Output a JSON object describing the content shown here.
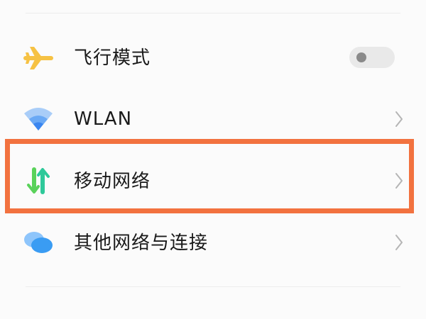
{
  "settings": {
    "items": [
      {
        "label": "飞行模式",
        "icon": "airplane-icon",
        "control": "toggle",
        "toggle_on": false
      },
      {
        "label": "WLAN",
        "icon": "wifi-icon",
        "control": "chevron"
      },
      {
        "label": "移动网络",
        "icon": "mobile-data-icon",
        "control": "chevron",
        "highlighted": true
      },
      {
        "label": "其他网络与连接",
        "icon": "bubbles-icon",
        "control": "chevron"
      }
    ]
  },
  "colors": {
    "highlight_border": "#f2723f",
    "airplane_icon": "#f6c244",
    "wifi_icon": "#3a86f0",
    "mobile_data_up": "#2ec99a",
    "mobile_data_down": "#5ad25a",
    "bubbles_icon": "#3a9cf3"
  }
}
